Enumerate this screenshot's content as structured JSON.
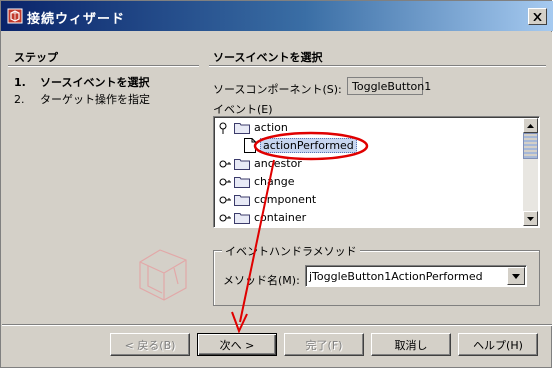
{
  "window": {
    "title": "接続ウィザード"
  },
  "steps_pane": {
    "heading": "ステップ",
    "steps": [
      {
        "num": "1.",
        "label": "ソースイベントを選択",
        "active": true
      },
      {
        "num": "2.",
        "label": "ターゲット操作を指定",
        "active": false
      }
    ]
  },
  "main": {
    "heading": "ソースイベントを選択",
    "source_component_label": "ソースコンポーネント(S):",
    "source_component_value": "ToggleButton1",
    "events_label": "イベント(E)",
    "tree": [
      {
        "label": "action",
        "expanded": true,
        "depth": 0
      },
      {
        "label": "actionPerformed",
        "selected": true,
        "depth": 1
      },
      {
        "label": "ancestor",
        "expanded": false,
        "depth": 0
      },
      {
        "label": "change",
        "expanded": false,
        "depth": 0
      },
      {
        "label": "component",
        "expanded": false,
        "depth": 0
      },
      {
        "label": "container",
        "expanded": false,
        "depth": 0
      }
    ],
    "handler_group": {
      "legend": "イベントハンドラメソッド",
      "method_label": "メソッド名(M):",
      "method_value": "jToggleButton1ActionPerformed"
    }
  },
  "buttons": {
    "back": "< 戻る(B)",
    "next": "次へ >",
    "finish": "完了(F)",
    "cancel": "取消し",
    "help": "ヘルプ(H)"
  },
  "colors": {
    "annotation": "#e00000",
    "titlebar_start": "#0a246a",
    "titlebar_end": "#a6caf0"
  },
  "icons": {
    "title": "wizard-app-icon",
    "close": "close-icon",
    "tree_toggle": "tree-toggle-icon",
    "folder": "folder-icon",
    "document": "document-icon"
  }
}
